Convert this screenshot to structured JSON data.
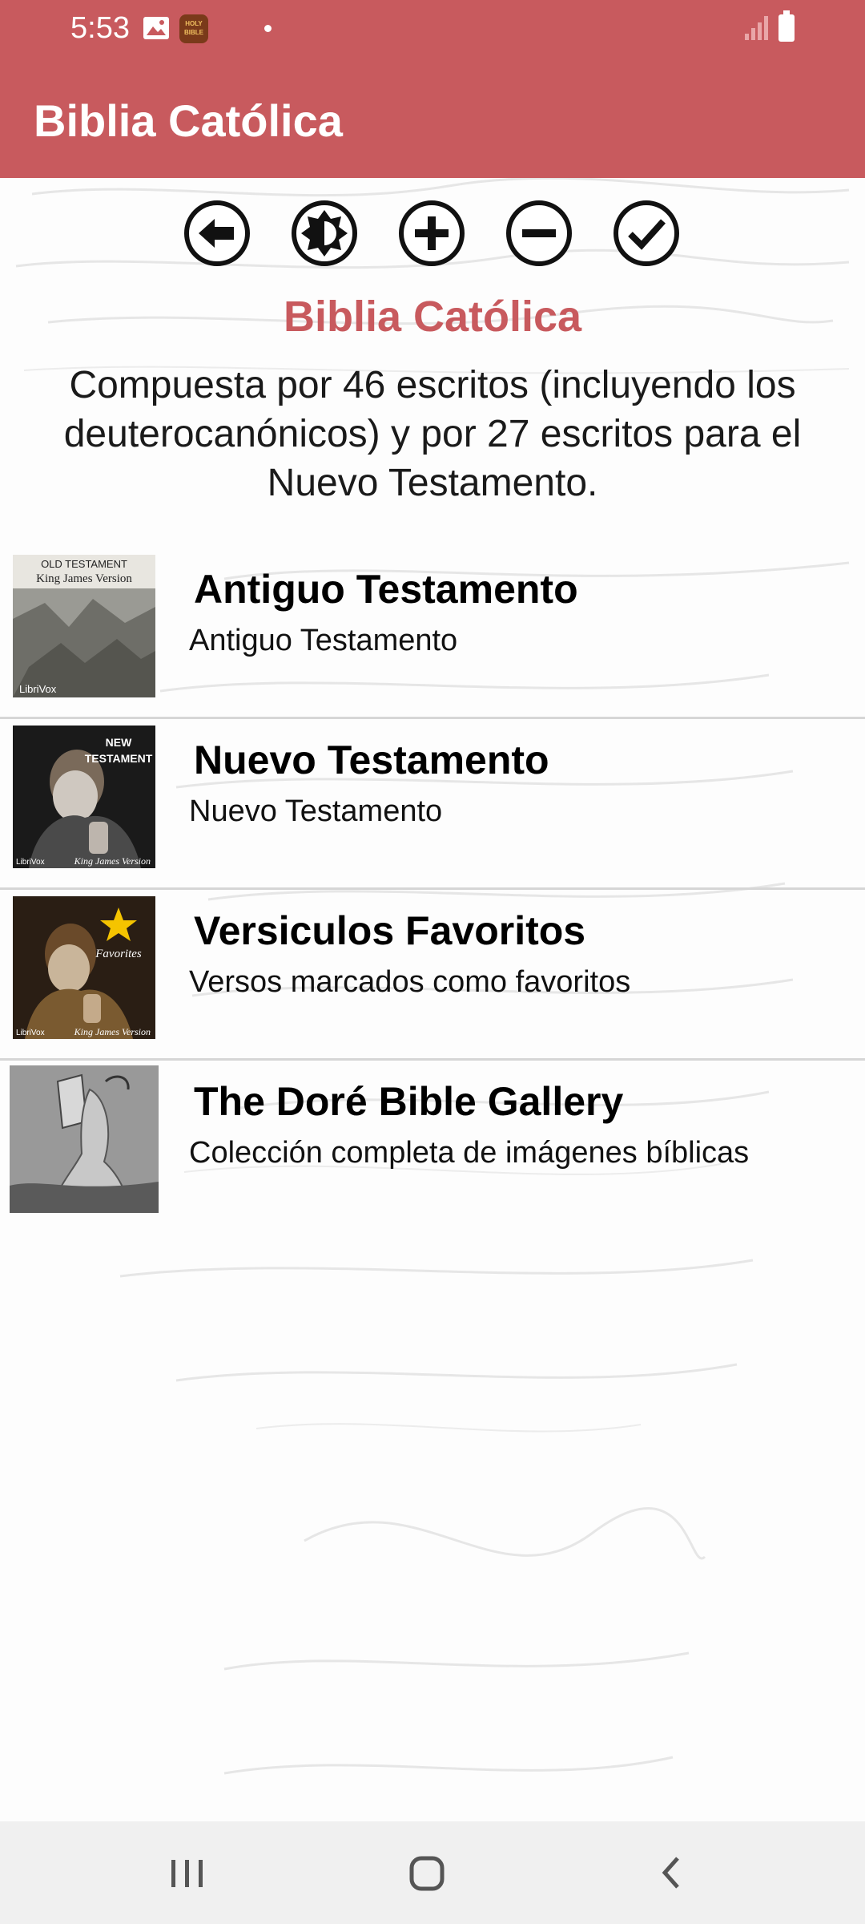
{
  "status_bar": {
    "time": "5:53",
    "bible_icon_text": "HOLY BIBLE"
  },
  "app_bar": {
    "title": "Biblia Católica"
  },
  "toolbar": {
    "buttons": [
      {
        "name": "back-button",
        "icon": "arrow-left-icon"
      },
      {
        "name": "brightness-button",
        "icon": "brightness-icon"
      },
      {
        "name": "zoom-in-button",
        "icon": "plus-circle-icon"
      },
      {
        "name": "zoom-out-button",
        "icon": "minus-circle-icon"
      },
      {
        "name": "confirm-button",
        "icon": "check-circle-icon"
      }
    ]
  },
  "section": {
    "title": "Biblia Católica",
    "description": "Compuesta por 46 escritos (incluyendo los deuterocanónicos) y por 27 escritos para el Nuevo Testamento."
  },
  "list": [
    {
      "title": "Antiguo Testamento",
      "subtitle": "Antiguo Testamento",
      "thumb_top": "OLD TESTAMENT",
      "thumb_mid": "King James Version",
      "thumb_bottom": "LibriVox"
    },
    {
      "title": "Nuevo Testamento",
      "subtitle": "Nuevo Testamento",
      "thumb_top": "NEW",
      "thumb_mid": "TESTAMENT",
      "thumb_bottom": "King James Version",
      "thumb_left": "LibriVox"
    },
    {
      "title": "Versiculos Favoritos",
      "subtitle": "Versos marcados como favoritos",
      "thumb_top": "Favorites",
      "thumb_bottom": "King James Version",
      "thumb_left": "LibriVox"
    },
    {
      "title": "The Doré Bible Gallery",
      "subtitle": "Colección completa de imágenes bíblicas"
    }
  ],
  "colors": {
    "accent": "#c85a5e",
    "navbar": "#f0f0f0"
  }
}
